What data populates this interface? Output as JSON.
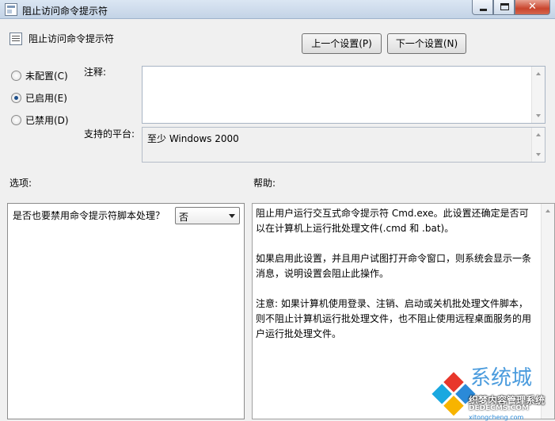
{
  "window": {
    "title": "阻止访问命令提示符",
    "controls": {
      "minimize": "minimize-icon",
      "maximize": "maximize-icon",
      "close": "✕"
    }
  },
  "header": {
    "policy_name": "阻止访问命令提示符",
    "prev_button": "上一个设置(P)",
    "next_button": "下一个设置(N)"
  },
  "state": {
    "options": [
      {
        "label": "未配置(C)",
        "checked": false
      },
      {
        "label": "已启用(E)",
        "checked": true
      },
      {
        "label": "已禁用(D)",
        "checked": false
      }
    ]
  },
  "comment": {
    "label": "注释:",
    "value": ""
  },
  "platform": {
    "label": "支持的平台:",
    "value": "至少 Windows 2000"
  },
  "options_section": {
    "label": "选项:",
    "question": "是否也要禁用命令提示符脚本处理？",
    "select_value": "否"
  },
  "help_section": {
    "label": "帮助:",
    "paragraphs": [
      "阻止用户运行交互式命令提示符 Cmd.exe。此设置还确定是否可以在计算机上运行批处理文件(.cmd 和 .bat)。",
      "如果启用此设置，并且用户试图打开命令窗口，则系统会显示一条消息，说明设置会阻止此操作。",
      "注意: 如果计算机使用登录、注销、启动或关机批处理文件脚本，则不阻止计算机运行批处理文件，也不阻止使用远程桌面服务的用户运行批处理文件。"
    ]
  },
  "watermark": {
    "big": "系统城",
    "cn": "织梦内容管理系统",
    "site": "DEDECMS.COM",
    "sub": "xitongcheng.com"
  },
  "colors": {
    "titlebar": "#c3d3e6",
    "radio_checked": "#1d4f8a",
    "close_button": "#c9452d"
  }
}
